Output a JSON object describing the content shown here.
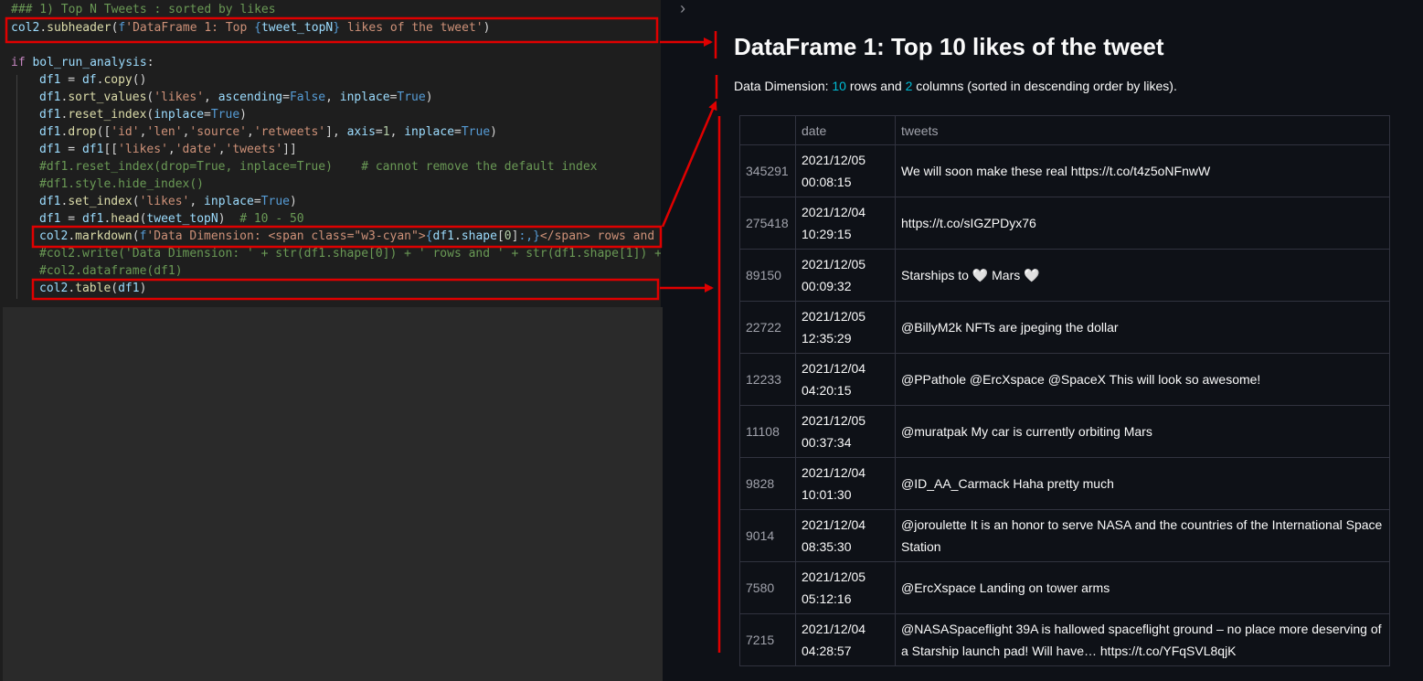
{
  "code": {
    "lines": [
      "### 1) Top N Tweets : sorted by likes",
      "col2.subheader(f'DataFrame 1: Top {tweet_topN} likes of the tweet')",
      "",
      "if bol_run_analysis:",
      "    df1 = df.copy()",
      "    df1.sort_values('likes', ascending=False, inplace=True)",
      "    df1.reset_index(inplace=True)",
      "    df1.drop(['id','len','source','retweets'], axis=1, inplace=True)",
      "    df1 = df1[['likes','date','tweets']]",
      "    #df1.reset_index(drop=True, inplace=True)    # cannot remove the default index",
      "    #df1.style.hide_index()",
      "    df1.set_index('likes', inplace=True)",
      "    df1 = df1.head(tweet_topN)  # 10 - 50",
      "    col2.markdown(f'Data Dimension: <span class=\"w3-cyan\">{df1.shape[0]:,}</span> rows and <",
      "    #col2.write('Data Dimension: ' + str(df1.shape[0]) + ' rows and ' + str(df1.shape[1]) +",
      "    #col2.dataframe(df1)",
      "    col2.table(df1)"
    ]
  },
  "app": {
    "title": "DataFrame 1: Top 10 likes of the tweet",
    "dimension": {
      "prefix": "Data Dimension: ",
      "rows": "10",
      "middle": " rows and ",
      "cols": "2",
      "suffix": " columns (sorted in descending order by likes)."
    },
    "table": {
      "columns": [
        "",
        "date",
        "tweets"
      ],
      "rows": [
        {
          "likes": "345291",
          "date": "2021/12/05",
          "time": "00:08:15",
          "tweet": "We will soon make these real https://t.co/t4z5oNFnwW"
        },
        {
          "likes": "275418",
          "date": "2021/12/04",
          "time": "10:29:15",
          "tweet": "https://t.co/sIGZPDyx76"
        },
        {
          "likes": "89150",
          "date": "2021/12/05",
          "time": "00:09:32",
          "tweet": "Starships to 🤍 Mars 🤍"
        },
        {
          "likes": "22722",
          "date": "2021/12/05",
          "time": "12:35:29",
          "tweet": "@BillyM2k NFTs are jpeging the dollar"
        },
        {
          "likes": "12233",
          "date": "2021/12/04",
          "time": "04:20:15",
          "tweet": "@PPathole @ErcXspace @SpaceX This will look so awesome!"
        },
        {
          "likes": "11108",
          "date": "2021/12/05",
          "time": "00:37:34",
          "tweet": "@muratpak My car is currently orbiting Mars"
        },
        {
          "likes": "9828",
          "date": "2021/12/04",
          "time": "10:01:30",
          "tweet": "@ID_AA_Carmack Haha pretty much"
        },
        {
          "likes": "9014",
          "date": "2021/12/04",
          "time": "08:35:30",
          "tweet": "@joroulette It is an honor to serve NASA and the countries of the International Space Station"
        },
        {
          "likes": "7580",
          "date": "2021/12/05",
          "time": "05:12:16",
          "tweet": "@ErcXspace Landing on tower arms"
        },
        {
          "likes": "7215",
          "date": "2021/12/04",
          "time": "04:28:57",
          "tweet": "@NASASpaceflight 39A is hallowed spaceflight ground – no place more deserving of a Starship launch pad! Will have… https://t.co/YFqSVL8qjK"
        }
      ]
    }
  },
  "colors": {
    "annotation": "#e00000",
    "cyan": "#00bcd4",
    "background": "#0e1117",
    "editor": "#1e1e1e"
  },
  "icons": {
    "sidebar_toggle": "chevron-right-icon"
  }
}
